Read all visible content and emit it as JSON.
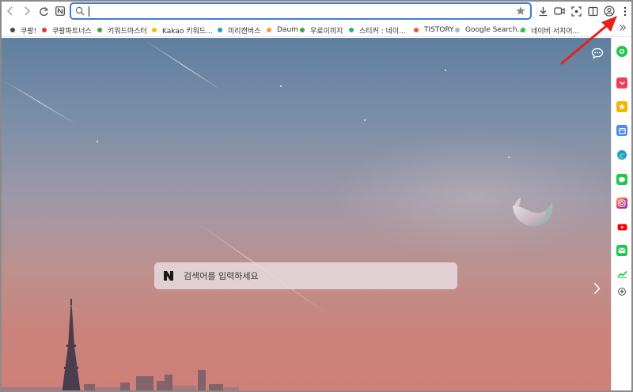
{
  "toolbar": {
    "address_value": "",
    "buttons": [
      "back",
      "forward",
      "reload",
      "naver-home"
    ]
  },
  "bookmarks": [
    {
      "label": "쿠팡!",
      "color": "#4a4a4a"
    },
    {
      "label": "쿠팡파트너스",
      "color": "#e03a3a"
    },
    {
      "label": "키워드마스터",
      "color": "#3aa64a"
    },
    {
      "label": "Kakao 키워드...",
      "color": "#f2c200"
    },
    {
      "label": "미리캔버스",
      "color": "#1fa0c8"
    },
    {
      "label": "Daum",
      "color": "#f0a030"
    },
    {
      "label": "우료이미지",
      "color": "#3aa64a"
    },
    {
      "label": "스티커 : 네이...",
      "color": "#1ab394"
    },
    {
      "label": "TISTORY",
      "color": "#e85a3a"
    },
    {
      "label": "Google Search...",
      "color": "#9ab8e0"
    },
    {
      "label": "네이버 서치어...",
      "color": "#1ec74a"
    }
  ],
  "search": {
    "placeholder": "검색어를 입력하세요",
    "logo": "N"
  },
  "sidebar_icons": [
    {
      "name": "naver-green-icon",
      "color": "#1ec74a"
    },
    {
      "name": "pocket-icon",
      "color": "#ef3f56"
    },
    {
      "name": "bookmark-star-icon",
      "color": "#f5b400"
    },
    {
      "name": "calendar-icon",
      "color": "#4a8ae8"
    },
    {
      "name": "edge-icon",
      "color": "#1e9be0"
    },
    {
      "name": "chat-green-icon",
      "color": "#1ec74a"
    },
    {
      "name": "instagram-icon",
      "color": "#d6307a"
    },
    {
      "name": "youtube-icon",
      "color": "#ff0000"
    },
    {
      "name": "naver-mail-icon",
      "color": "#1ec74a"
    },
    {
      "name": "stocks-icon",
      "color": "#1ec74a"
    },
    {
      "name": "add-icon",
      "color": "#333333"
    }
  ],
  "colors": {
    "accent": "#3c7be0",
    "annotation_arrow": "#e3231c"
  }
}
